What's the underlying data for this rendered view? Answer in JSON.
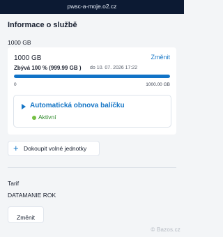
{
  "browser": {
    "url": "pwsc-a-moje.o2.cz"
  },
  "service": {
    "title": "Informace o službě",
    "data_label": "1000 GB",
    "amount": "1000 GB",
    "change_label": "Změnit",
    "remaining": "Zbývá 100 % (999.99 GB )",
    "remaining_until": "do 10. 07. 2026 17:22",
    "progress_fraction": 1.0,
    "scale_min": "0",
    "scale_max": "1000.00 GB",
    "auto_renew": {
      "title": "Automatická obnova balíčku",
      "status": "Aktivní",
      "status_color": "#75c043"
    },
    "buy_button": {
      "icon": "plus-icon",
      "label": "Dokoupit volné jednotky"
    }
  },
  "tariff": {
    "label": "Tarif",
    "value": "DATAMANIE ROK",
    "change_label": "Změnit"
  },
  "watermark": "© Bazos.cz",
  "colors": {
    "accent": "#1476c6",
    "topbar": "#0c1a33",
    "background": "#f3f5f7"
  }
}
